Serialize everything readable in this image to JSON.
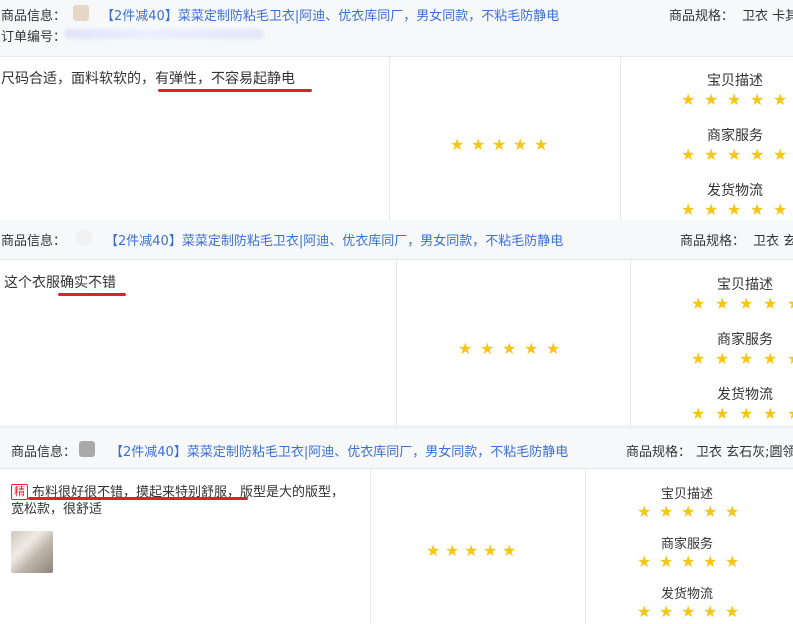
{
  "label_product_info": "商品信息：",
  "label_product_spec": "商品规格：",
  "label_order_no": "订单编号：",
  "product_title": "【2件减40】菜菜定制防粘毛卫衣|阿迪、优衣库同厂，男女同款，不粘毛防静电",
  "rating_labels": {
    "desc": "宝贝描述",
    "service": "商家服务",
    "logistics": "发货物流"
  },
  "star_glyph": "★",
  "colors": {
    "link": "#3a6fd8",
    "star": "#f5c518",
    "underline": "#d9232d",
    "header_bg": "#f7f8fa"
  },
  "reviews": [
    {
      "spec_value": "卫衣 卡其",
      "text_plain": "尺码合适，面料软软的，",
      "text_highlight": "有弹性，不容易起静电"
    },
    {
      "spec_value": "卫衣 玄",
      "text_highlight": "这个衣服确实不错"
    },
    {
      "spec_value": "卫衣 玄石灰;圆领",
      "badge": "精",
      "text_highlight": "布料很好很不错，摸起来特别舒服，",
      "text_rest": "版型是大的版型，",
      "text_line2": "宽松款，很舒适"
    }
  ]
}
